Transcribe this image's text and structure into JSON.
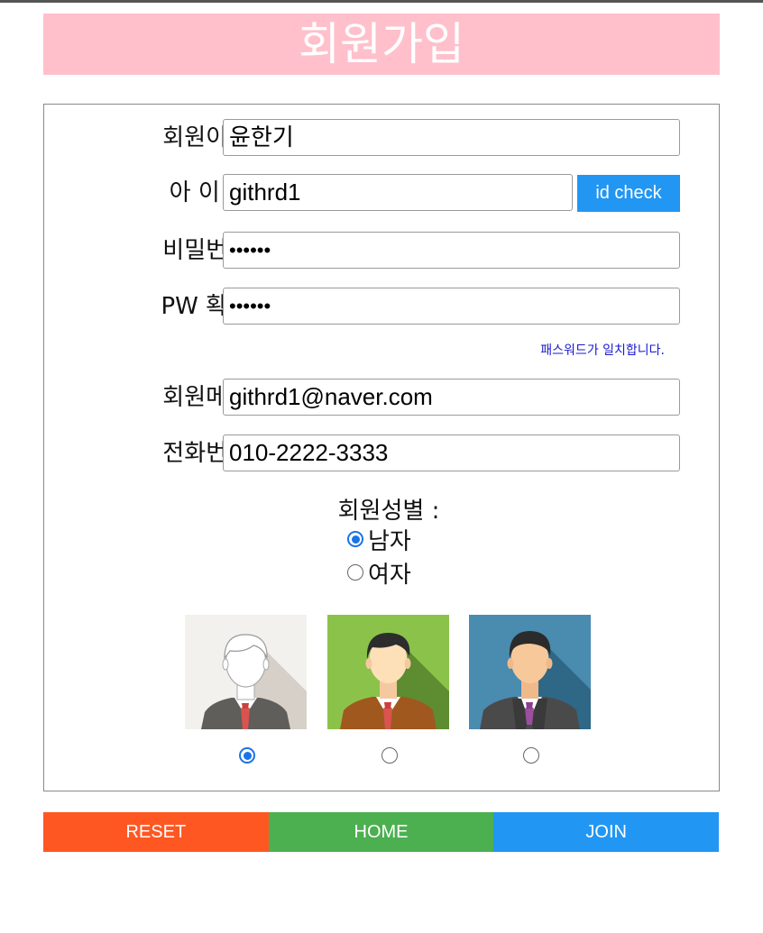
{
  "header": {
    "title": "회원가입"
  },
  "form": {
    "name": {
      "label": "회원이름 :",
      "value": "윤한기"
    },
    "id": {
      "label": "아 이 디 :",
      "value": "githrd1",
      "check_label": "id check"
    },
    "password": {
      "label": "비밀번호 :",
      "value": "••••••"
    },
    "password_confirm": {
      "label": "PW 확인 :",
      "value": "••••••",
      "message": "패스워드가 일치합니다."
    },
    "email": {
      "label": "회원메일 :",
      "value": "githrd1@naver.com"
    },
    "phone": {
      "label": "전화번호 :",
      "value": "010-2222-3333"
    },
    "gender": {
      "label": "회원성별 :",
      "options": [
        {
          "label": "남자",
          "checked": true
        },
        {
          "label": "여자",
          "checked": false
        }
      ]
    },
    "avatars": [
      {
        "icon": "avatar-white-icon",
        "checked": true
      },
      {
        "icon": "avatar-green-icon",
        "checked": false
      },
      {
        "icon": "avatar-blue-icon",
        "checked": false
      }
    ]
  },
  "buttons": {
    "reset": "RESET",
    "home": "HOME",
    "join": "JOIN"
  },
  "colors": {
    "header_bg": "#ffc0cb",
    "reset": "#ff5722",
    "home": "#4caf50",
    "join": "#2196f3",
    "check_button": "#2196f3",
    "message": "#1a1ad0"
  }
}
